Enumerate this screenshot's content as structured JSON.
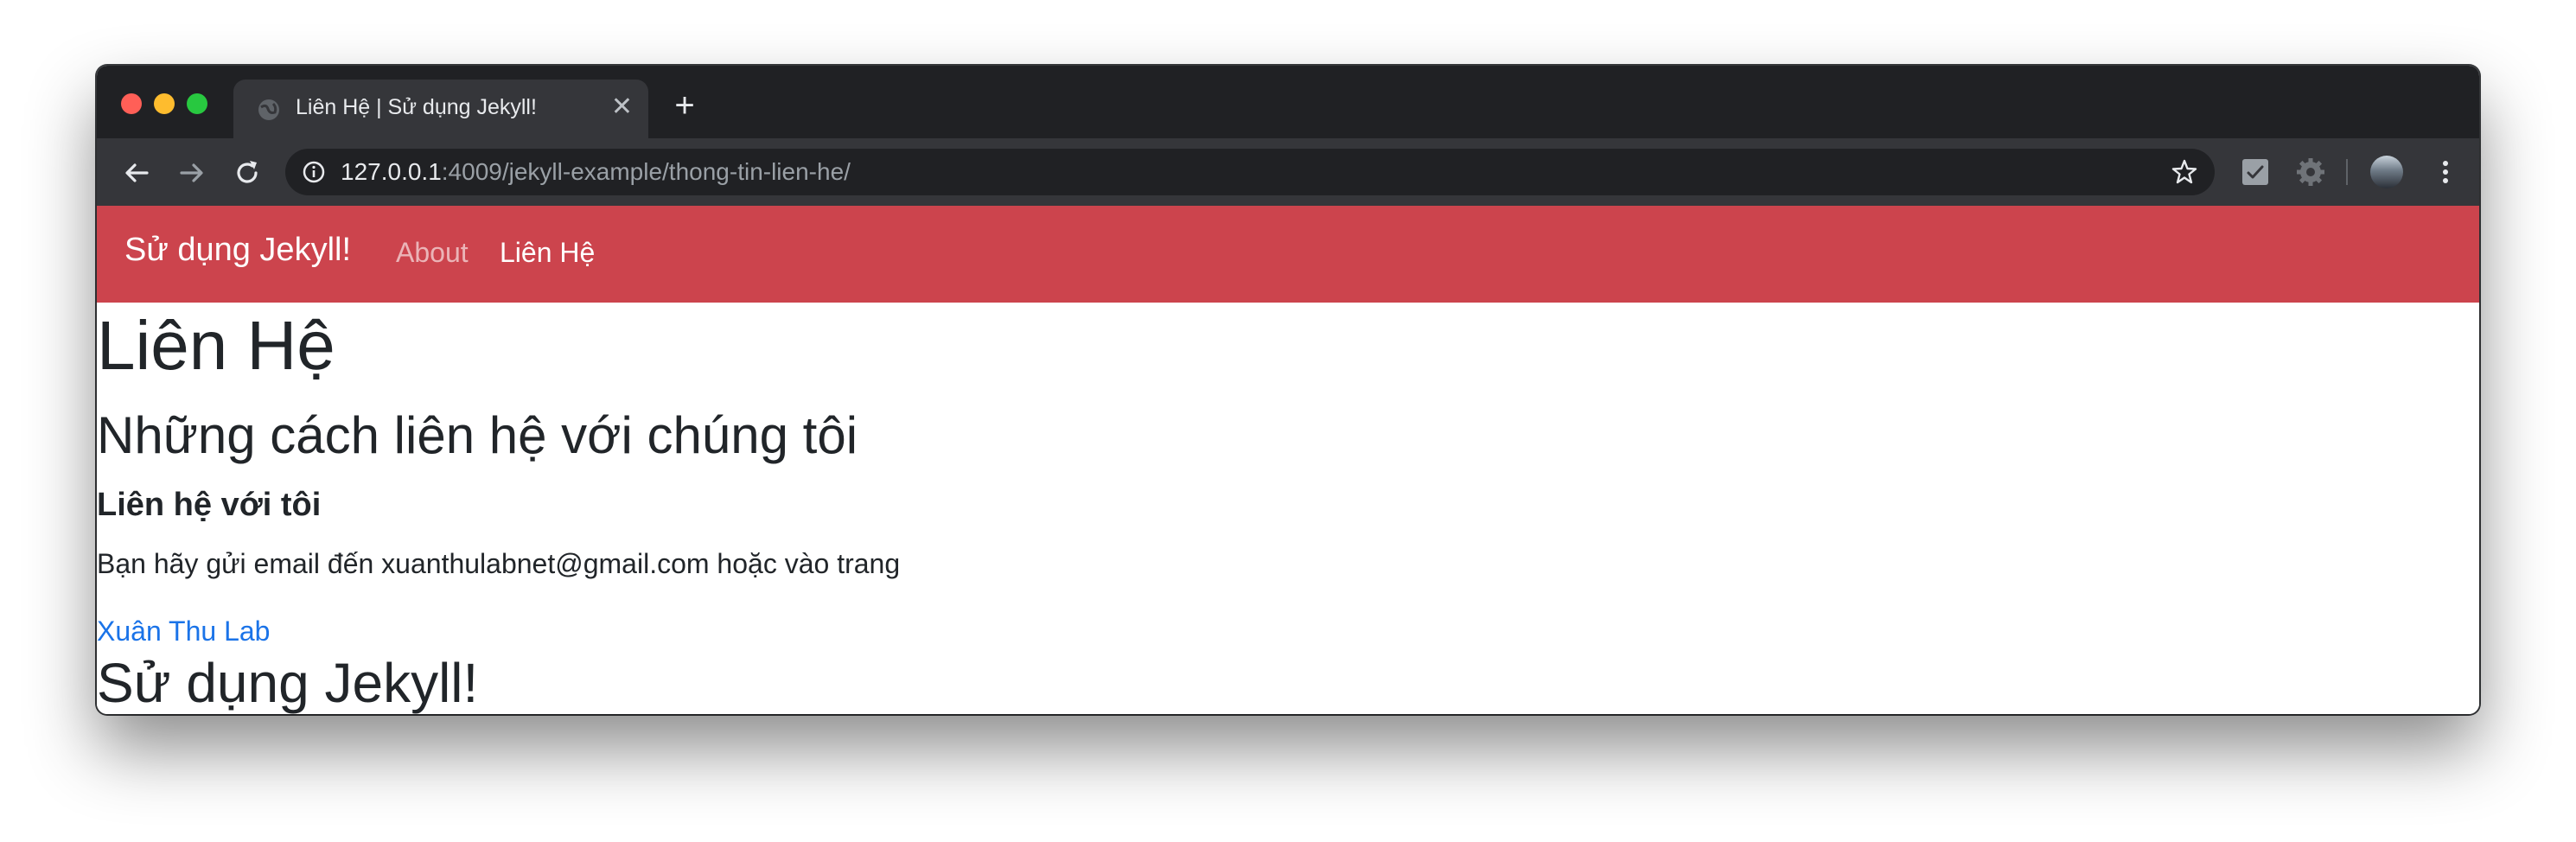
{
  "browser": {
    "tab": {
      "title": "Liên Hệ | Sử dụng Jekyll!",
      "close_label": "✕"
    },
    "new_tab_label": "+",
    "address": {
      "host": "127.0.0.1",
      "rest": ":4009/jekyll-example/thong-tin-lien-he/"
    },
    "colors": {
      "frame": "#202124",
      "toolbar": "#35363a"
    }
  },
  "navbar": {
    "brand": "Sử dụng Jekyll!",
    "links": [
      {
        "label": "About"
      },
      {
        "label": "Liên Hệ"
      }
    ],
    "color": "#cc444d"
  },
  "content": {
    "title": "Liên Hệ",
    "subtitle": "Những cách liên hệ với chúng tôi",
    "section_heading": "Liên hệ với tôi",
    "paragraph": "Bạn hãy gửi email đến xuanthulabnet@gmail.com hoặc vào trang",
    "link_text": "Xuân Thu Lab",
    "footer_title": "Sử dụng Jekyll!"
  }
}
